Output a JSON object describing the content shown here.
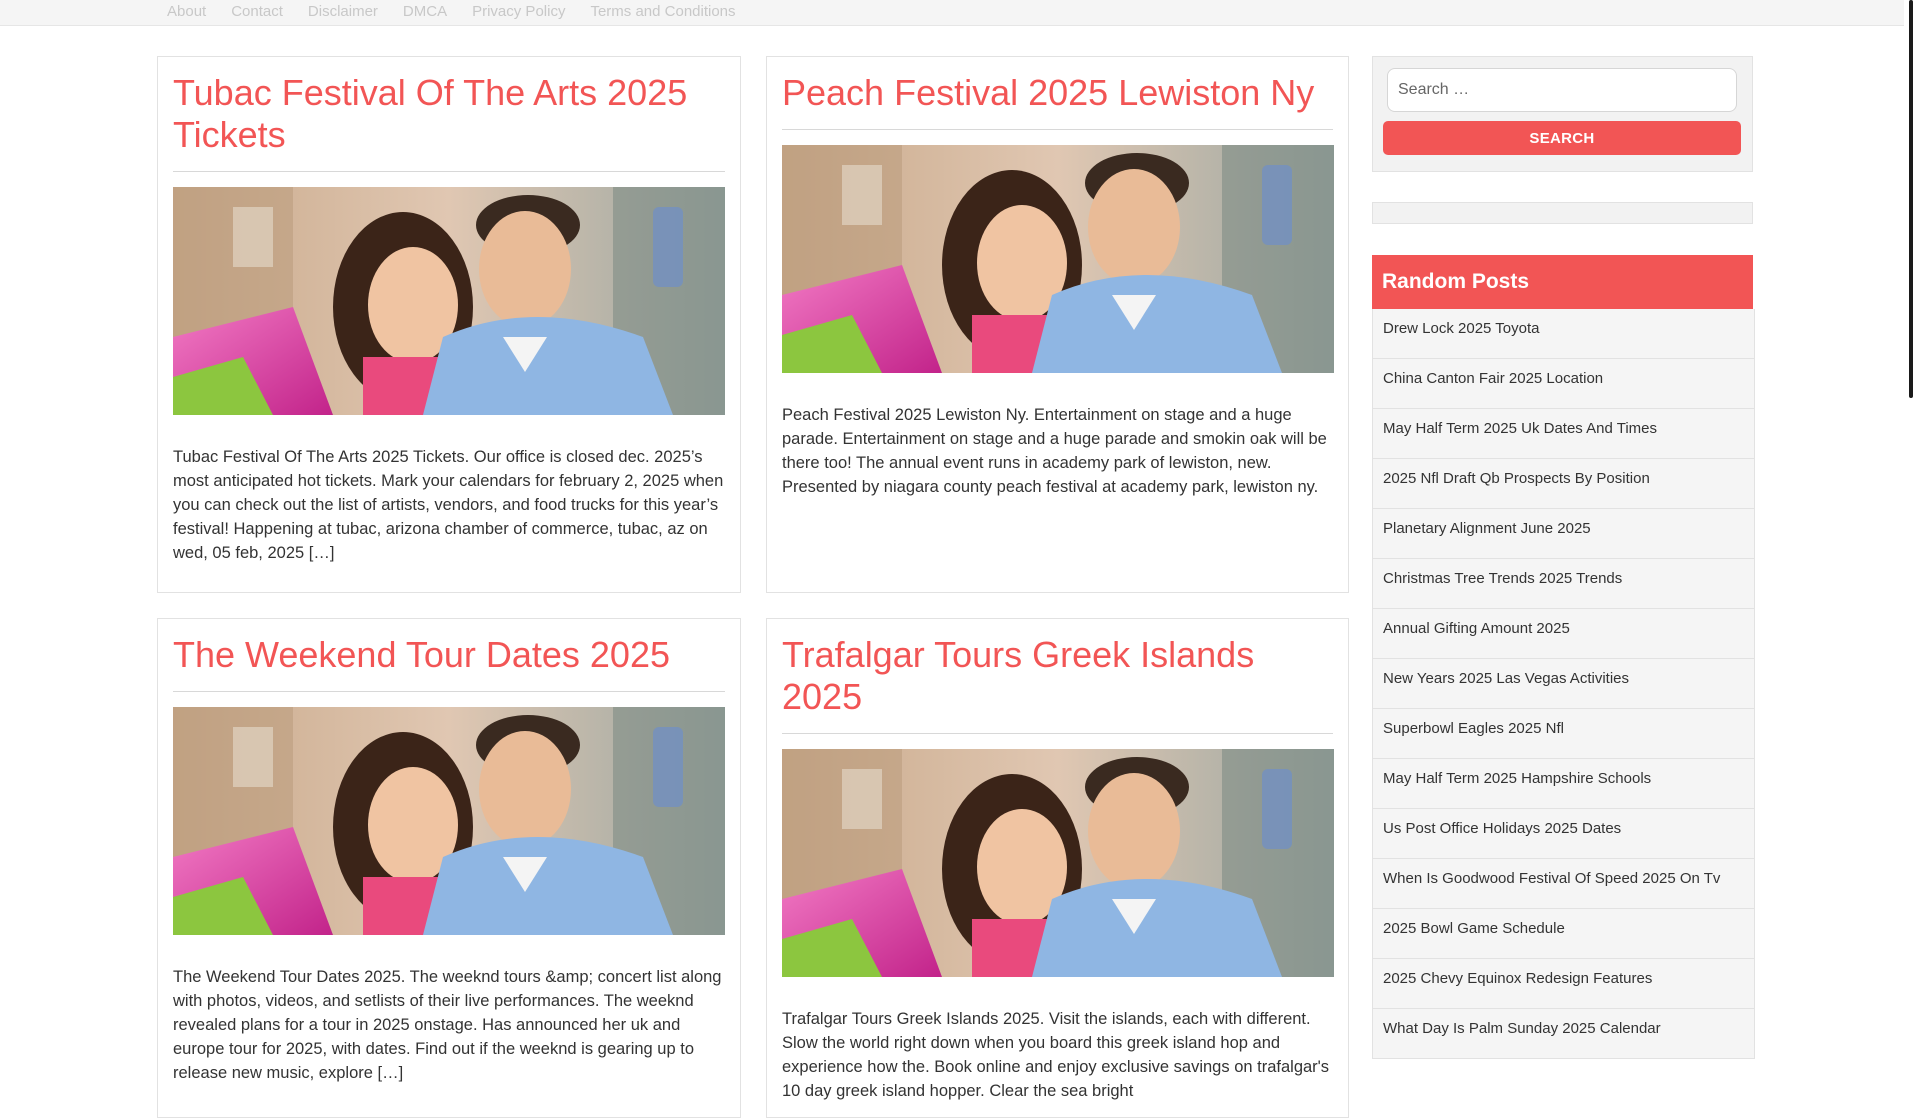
{
  "topnav": {
    "items": [
      "About",
      "Contact",
      "Disclaimer",
      "DMCA",
      "Privacy Policy",
      "Terms and Conditions"
    ]
  },
  "posts": [
    {
      "title": "Tubac Festival Of The Arts 2025 Tickets",
      "excerpt": "Tubac Festival Of The Arts 2025 Tickets. Our office is closed dec. 2025’s most anticipated hot tickets. Mark your calendars for february 2, 2025 when you can check out the list of artists, vendors, and food trucks for this year’s festival! Happening at tubac, arizona chamber of commerce, tubac, az on wed, 05 feb, 2025 […]"
    },
    {
      "title": "Peach Festival 2025 Lewiston Ny",
      "excerpt": "Peach Festival 2025 Lewiston Ny. Entertainment on stage and a huge parade. Entertainment on stage and a huge parade and smokin oak will be there too! The annual event runs in academy park of lewiston, new. Presented by niagara county peach festival at academy park, lewiston ny."
    },
    {
      "title": "The Weekend Tour Dates 2025",
      "excerpt": "The Weekend Tour Dates 2025. The weeknd tours &amp; concert list along with photos, videos, and setlists of their live performances. The weeknd revealed plans for a tour in 2025 onstage. Has announced her uk and europe tour for 2025, with dates. Find out if the weeknd is gearing up to release new music, explore […]"
    },
    {
      "title": "Trafalgar Tours Greek Islands 2025",
      "excerpt": "Trafalgar Tours Greek Islands 2025. Visit the islands, each with different. Slow the world right down when you board this greek island hop and experience how the. Book online and enjoy exclusive savings on trafalgar's 10 day greek island hopper. Clear the sea bright"
    }
  ],
  "search": {
    "placeholder": "Search …",
    "button_label": "Search"
  },
  "random_posts": {
    "heading": "Random Posts",
    "items": [
      "Drew Lock 2025 Toyota",
      "China Canton Fair 2025 Location",
      "May Half Term 2025 Uk Dates And Times",
      "2025 Nfl Draft Qb Prospects By Position",
      "Planetary Alignment June 2025",
      "Christmas Tree Trends 2025 Trends",
      "Annual Gifting Amount 2025",
      "New Years 2025 Las Vegas Activities",
      "Superbowl Eagles 2025 Nfl",
      "May Half Term 2025 Hampshire Schools",
      "Us Post Office Holidays 2025 Dates",
      "When Is Goodwood Festival Of Speed 2025 On Tv",
      "2025 Bowl Game Schedule",
      "2025 Chevy Equinox Redesign Features",
      "What Day Is Palm Sunday 2025 Calendar"
    ]
  },
  "colors": {
    "accent": "#f25555",
    "text": "#333333",
    "border": "#e2e2e2"
  }
}
